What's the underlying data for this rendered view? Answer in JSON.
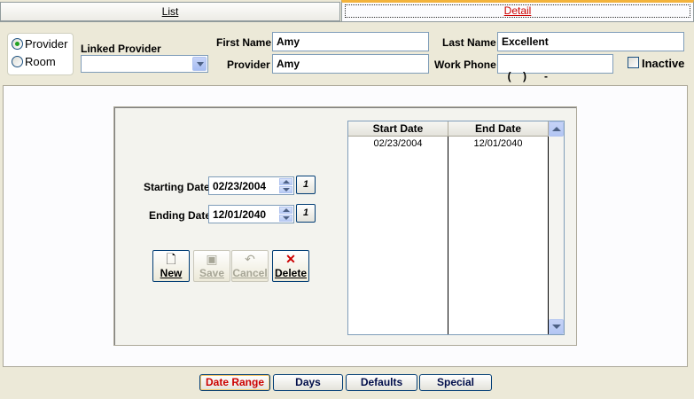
{
  "tabs": {
    "list": "List",
    "detail": "Detail"
  },
  "type_radio": {
    "provider": "Provider",
    "room": "Room",
    "selected": "Provider"
  },
  "linked_provider": {
    "label": "Linked Provider",
    "value": ""
  },
  "first_name": {
    "label": "First Name",
    "value": "Amy"
  },
  "last_name": {
    "label": "Last Name",
    "value": "Excellent"
  },
  "provider": {
    "label": "Provider",
    "value": "Amy"
  },
  "work_phone": {
    "label": "Work Phone",
    "value": "(    )      -"
  },
  "inactive": {
    "label": "Inactive",
    "checked": false
  },
  "starting_date": {
    "label": "Starting Date",
    "value": "02/23/2004"
  },
  "ending_date": {
    "label": "Ending Date",
    "value": "12/01/2040"
  },
  "buttons": {
    "new": "New",
    "save": "Save",
    "cancel": "Cancel",
    "delete": "Delete"
  },
  "grid": {
    "columns": [
      "Start Date",
      "End Date"
    ],
    "rows": [
      [
        "02/23/2004",
        "12/01/2040"
      ]
    ]
  },
  "bottom_tabs": {
    "date_range": "Date Range",
    "days": "Days",
    "defaults": "Defaults",
    "special": "Special",
    "active": "Date Range"
  },
  "icons": {
    "calendar": "calendar-icon",
    "new": "new-document-icon",
    "save": "floppy-disk-icon",
    "cancel": "undo-icon",
    "delete": "red-x-icon"
  },
  "colors": {
    "accent_red": "#cc0000",
    "tab_highlight": "#f3b33b"
  }
}
